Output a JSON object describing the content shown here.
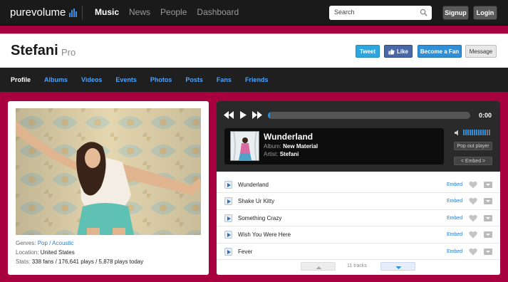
{
  "topbar": {
    "logo": "purevolume",
    "nav": [
      "Music",
      "News",
      "People",
      "Dashboard"
    ],
    "search_placeholder": "Search",
    "signup": "Signup",
    "login": "Login"
  },
  "profile": {
    "name": "Stefani",
    "tag": "Pro",
    "buttons": {
      "tweet": "Tweet",
      "like": "Like",
      "fan": "Become a Fan",
      "message": "Message"
    },
    "tabs": [
      "Profile",
      "Albums",
      "Videos",
      "Events",
      "Photos",
      "Posts",
      "Fans",
      "Friends"
    ]
  },
  "info": {
    "genres_label": "Genres:",
    "genre1": "Pop",
    "genre_sep": " / ",
    "genre2": "Acoustic",
    "location_label": "Location:",
    "location": "United States",
    "stats_label": "Stats:",
    "stats": "338 fans / 176,641 plays / 5,878 plays today"
  },
  "player": {
    "time": "0:00",
    "progress": 0.01,
    "title": "Wunderland",
    "album_label": "Album:",
    "album": "New Material",
    "artist_label": "Artist:",
    "artist": "Stefani",
    "popout": "Pop out player",
    "embed": "< Embed >"
  },
  "tracks": [
    {
      "name": "Wunderland",
      "embed": "Embed"
    },
    {
      "name": "Shake Ur Kitty",
      "embed": "Embed"
    },
    {
      "name": "Something Crazy",
      "embed": "Embed"
    },
    {
      "name": "Wish You Were Here",
      "embed": "Embed"
    },
    {
      "name": "Fever",
      "embed": "Embed"
    }
  ],
  "track_count": "11 tracks",
  "colors": {
    "accent": "#2f8fd8",
    "background": "#a8003f",
    "nav_bg": "#1a1a1a"
  }
}
